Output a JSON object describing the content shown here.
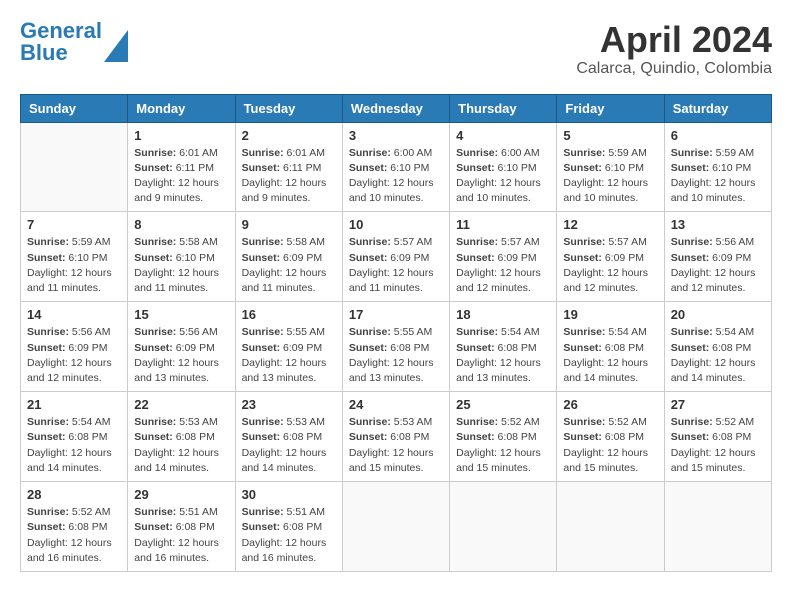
{
  "header": {
    "logo_line1": "General",
    "logo_line2": "Blue",
    "title": "April 2024",
    "subtitle": "Calarca, Quindio, Colombia"
  },
  "days_of_week": [
    "Sunday",
    "Monday",
    "Tuesday",
    "Wednesday",
    "Thursday",
    "Friday",
    "Saturday"
  ],
  "weeks": [
    [
      {
        "day": "",
        "info": ""
      },
      {
        "day": "1",
        "info": "Sunrise: 6:01 AM\nSunset: 6:11 PM\nDaylight: 12 hours\nand 9 minutes."
      },
      {
        "day": "2",
        "info": "Sunrise: 6:01 AM\nSunset: 6:11 PM\nDaylight: 12 hours\nand 9 minutes."
      },
      {
        "day": "3",
        "info": "Sunrise: 6:00 AM\nSunset: 6:10 PM\nDaylight: 12 hours\nand 10 minutes."
      },
      {
        "day": "4",
        "info": "Sunrise: 6:00 AM\nSunset: 6:10 PM\nDaylight: 12 hours\nand 10 minutes."
      },
      {
        "day": "5",
        "info": "Sunrise: 5:59 AM\nSunset: 6:10 PM\nDaylight: 12 hours\nand 10 minutes."
      },
      {
        "day": "6",
        "info": "Sunrise: 5:59 AM\nSunset: 6:10 PM\nDaylight: 12 hours\nand 10 minutes."
      }
    ],
    [
      {
        "day": "7",
        "info": "Sunrise: 5:59 AM\nSunset: 6:10 PM\nDaylight: 12 hours\nand 11 minutes."
      },
      {
        "day": "8",
        "info": "Sunrise: 5:58 AM\nSunset: 6:10 PM\nDaylight: 12 hours\nand 11 minutes."
      },
      {
        "day": "9",
        "info": "Sunrise: 5:58 AM\nSunset: 6:09 PM\nDaylight: 12 hours\nand 11 minutes."
      },
      {
        "day": "10",
        "info": "Sunrise: 5:57 AM\nSunset: 6:09 PM\nDaylight: 12 hours\nand 11 minutes."
      },
      {
        "day": "11",
        "info": "Sunrise: 5:57 AM\nSunset: 6:09 PM\nDaylight: 12 hours\nand 12 minutes."
      },
      {
        "day": "12",
        "info": "Sunrise: 5:57 AM\nSunset: 6:09 PM\nDaylight: 12 hours\nand 12 minutes."
      },
      {
        "day": "13",
        "info": "Sunrise: 5:56 AM\nSunset: 6:09 PM\nDaylight: 12 hours\nand 12 minutes."
      }
    ],
    [
      {
        "day": "14",
        "info": "Sunrise: 5:56 AM\nSunset: 6:09 PM\nDaylight: 12 hours\nand 12 minutes."
      },
      {
        "day": "15",
        "info": "Sunrise: 5:56 AM\nSunset: 6:09 PM\nDaylight: 12 hours\nand 13 minutes."
      },
      {
        "day": "16",
        "info": "Sunrise: 5:55 AM\nSunset: 6:09 PM\nDaylight: 12 hours\nand 13 minutes."
      },
      {
        "day": "17",
        "info": "Sunrise: 5:55 AM\nSunset: 6:08 PM\nDaylight: 12 hours\nand 13 minutes."
      },
      {
        "day": "18",
        "info": "Sunrise: 5:54 AM\nSunset: 6:08 PM\nDaylight: 12 hours\nand 13 minutes."
      },
      {
        "day": "19",
        "info": "Sunrise: 5:54 AM\nSunset: 6:08 PM\nDaylight: 12 hours\nand 14 minutes."
      },
      {
        "day": "20",
        "info": "Sunrise: 5:54 AM\nSunset: 6:08 PM\nDaylight: 12 hours\nand 14 minutes."
      }
    ],
    [
      {
        "day": "21",
        "info": "Sunrise: 5:54 AM\nSunset: 6:08 PM\nDaylight: 12 hours\nand 14 minutes."
      },
      {
        "day": "22",
        "info": "Sunrise: 5:53 AM\nSunset: 6:08 PM\nDaylight: 12 hours\nand 14 minutes."
      },
      {
        "day": "23",
        "info": "Sunrise: 5:53 AM\nSunset: 6:08 PM\nDaylight: 12 hours\nand 14 minutes."
      },
      {
        "day": "24",
        "info": "Sunrise: 5:53 AM\nSunset: 6:08 PM\nDaylight: 12 hours\nand 15 minutes."
      },
      {
        "day": "25",
        "info": "Sunrise: 5:52 AM\nSunset: 6:08 PM\nDaylight: 12 hours\nand 15 minutes."
      },
      {
        "day": "26",
        "info": "Sunrise: 5:52 AM\nSunset: 6:08 PM\nDaylight: 12 hours\nand 15 minutes."
      },
      {
        "day": "27",
        "info": "Sunrise: 5:52 AM\nSunset: 6:08 PM\nDaylight: 12 hours\nand 15 minutes."
      }
    ],
    [
      {
        "day": "28",
        "info": "Sunrise: 5:52 AM\nSunset: 6:08 PM\nDaylight: 12 hours\nand 16 minutes."
      },
      {
        "day": "29",
        "info": "Sunrise: 5:51 AM\nSunset: 6:08 PM\nDaylight: 12 hours\nand 16 minutes."
      },
      {
        "day": "30",
        "info": "Sunrise: 5:51 AM\nSunset: 6:08 PM\nDaylight: 12 hours\nand 16 minutes."
      },
      {
        "day": "",
        "info": ""
      },
      {
        "day": "",
        "info": ""
      },
      {
        "day": "",
        "info": ""
      },
      {
        "day": "",
        "info": ""
      }
    ]
  ]
}
